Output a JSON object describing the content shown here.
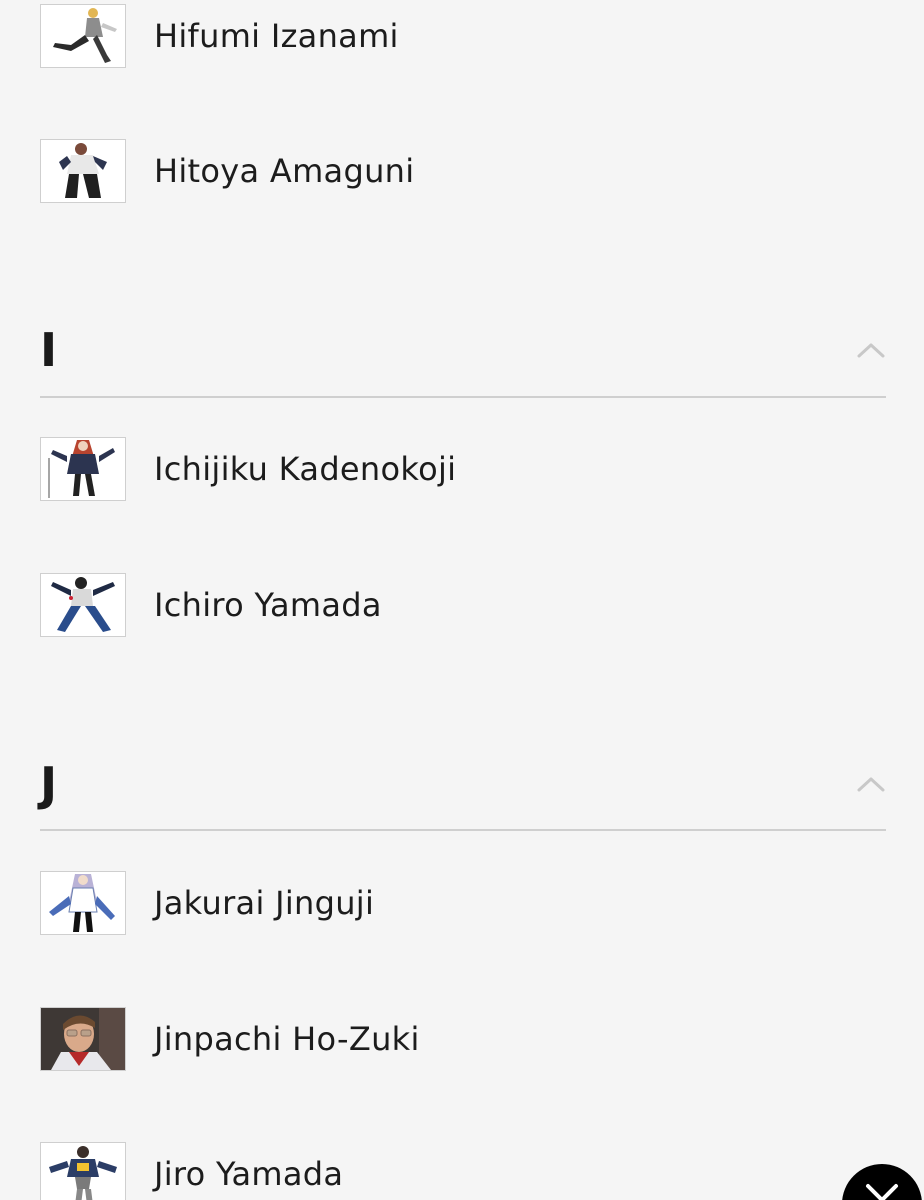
{
  "sections": [
    {
      "letter": "",
      "items": [
        {
          "name": "Hifumi Izanami",
          "thumb_icon": "character-portrait"
        },
        {
          "name": "Hitoya Amaguni",
          "thumb_icon": "character-portrait"
        }
      ]
    },
    {
      "letter": "I",
      "items": [
        {
          "name": "Ichijiku Kadenokoji",
          "thumb_icon": "character-portrait"
        },
        {
          "name": "Ichiro Yamada",
          "thumb_icon": "character-portrait"
        }
      ]
    },
    {
      "letter": "J",
      "items": [
        {
          "name": "Jakurai Jinguji",
          "thumb_icon": "character-portrait"
        },
        {
          "name": "Jinpachi Ho-Zuki",
          "thumb_icon": "actor-photo"
        },
        {
          "name": "Jiro Yamada",
          "thumb_icon": "character-portrait"
        }
      ]
    }
  ],
  "icons": {
    "section_toggle": "chevron-up-icon",
    "close": "close-icon"
  },
  "colors": {
    "background": "#f5f5f5",
    "text": "#1c1c1c",
    "divider": "#cfcfcf",
    "chevron": "#c8c8c8",
    "fab": "#000000"
  }
}
